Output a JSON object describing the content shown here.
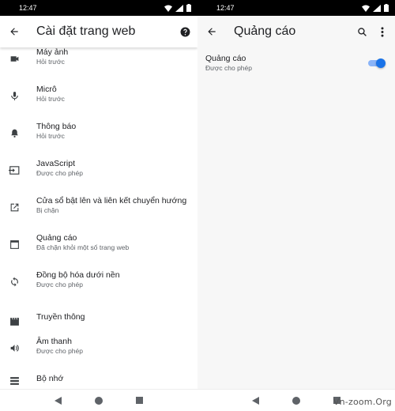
{
  "left": {
    "status_time": "12:47",
    "title": "Cài đặt trang web",
    "items": [
      {
        "icon": "camera-icon",
        "title": "Máy ảnh",
        "subtitle": "Hỏi trước"
      },
      {
        "icon": "microphone-icon",
        "title": "Micrô",
        "subtitle": "Hỏi trước"
      },
      {
        "icon": "bell-icon",
        "title": "Thông báo",
        "subtitle": "Hỏi trước"
      },
      {
        "icon": "javascript-icon",
        "title": "JavaScript",
        "subtitle": "Được cho phép"
      },
      {
        "icon": "open-in-new-icon",
        "title": "Cửa sổ bật lên và liên kết chuyển hướng",
        "subtitle": "Bị chặn"
      },
      {
        "icon": "ads-window-icon",
        "title": "Quảng cáo",
        "subtitle": "Đã chặn khỏi một số trang web"
      },
      {
        "icon": "sync-icon",
        "title": "Đồng bộ hóa dưới nền",
        "subtitle": "Được cho phép"
      },
      {
        "icon": "media-icon",
        "title": "Truyền thông",
        "subtitle": ""
      },
      {
        "icon": "volume-icon",
        "title": "Âm thanh",
        "subtitle": "Được cho phép"
      },
      {
        "icon": "storage-icon",
        "title": "Bộ nhớ",
        "subtitle": ""
      }
    ]
  },
  "right": {
    "status_time": "12:47",
    "title": "Quảng cáo",
    "setting": {
      "title": "Quảng cáo",
      "subtitle": "Được cho phép",
      "enabled": true
    }
  },
  "watermark": "Vn-zoom.Org",
  "colors": {
    "accent": "#1a73e8",
    "accent_track": "#8ab4f8",
    "status_bar": "#000000"
  }
}
